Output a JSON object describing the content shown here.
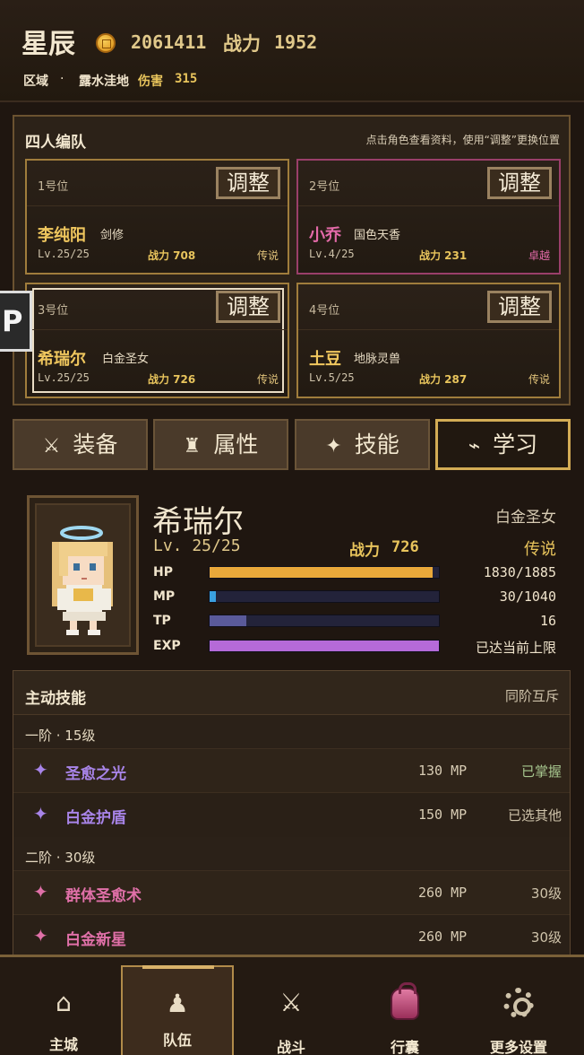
{
  "header": {
    "player_name": "星辰",
    "gold": "2061411",
    "power_label": "战力",
    "power_value": "1952",
    "region_label": "区域",
    "region_separator": "·",
    "region_name": "露水洼地",
    "damage_label": "伤害",
    "damage_value": "315"
  },
  "team": {
    "title": "四人编队",
    "hint": "点击角色查看资料，使用“调整”更换位置",
    "adjust_label": "调整",
    "slots": [
      {
        "pos": "1号位",
        "name": "李纯阳",
        "title": "剑修",
        "lv": "Lv.25/25",
        "power": "战力 708",
        "rank": "传说"
      },
      {
        "pos": "2号位",
        "name": "小乔",
        "title": "国色天香",
        "lv": "Lv.4/25",
        "power": "战力 231",
        "rank": "卓越"
      },
      {
        "pos": "3号位",
        "name": "希瑞尔",
        "title": "白金圣女",
        "lv": "Lv.25/25",
        "power": "战力 726",
        "rank": "传说"
      },
      {
        "pos": "4号位",
        "name": "土豆",
        "title": "地脉灵兽",
        "lv": "Lv.5/25",
        "power": "战力 287",
        "rank": "传说"
      }
    ],
    "side_tab": "P"
  },
  "tabs": [
    {
      "icon": "⚔",
      "label": "装备"
    },
    {
      "icon": "♜",
      "label": "属性"
    },
    {
      "icon": "✦",
      "label": "技能"
    },
    {
      "icon": "⌁",
      "label": "学习"
    }
  ],
  "hero": {
    "name": "希瑞尔",
    "class": "白金圣女",
    "lv": "Lv. 25/25",
    "power_label": "战力",
    "power_value": "726",
    "rank": "传说",
    "stats": [
      {
        "label": "HP",
        "value": "1830/1885",
        "fraction": 0.971,
        "color": "#e9a83a"
      },
      {
        "label": "MP",
        "value": "30/1040",
        "fraction": 0.029,
        "color": "#3aa0e0"
      },
      {
        "label": "TP",
        "value": "16",
        "fraction": 0.16,
        "color": "#5a5a9a"
      },
      {
        "label": "EXP",
        "value": "已达当前上限",
        "fraction": 1.0,
        "color": "#b56ad8"
      }
    ]
  },
  "skills": {
    "title": "主动技能",
    "note": "同阶互斥",
    "tiers": [
      {
        "label": "一阶 · 15级",
        "items": [
          {
            "name": "圣愈之光",
            "cost": "130 MP",
            "status": "已掌握",
            "color": "#a884e8"
          },
          {
            "name": "白金护盾",
            "cost": "150 MP",
            "status": "已选其他",
            "color": "#a884e8"
          }
        ]
      },
      {
        "label": "二阶 · 30级",
        "items": [
          {
            "name": "群体圣愈术",
            "cost": "260 MP",
            "status": "30级",
            "color": "#e070a8"
          },
          {
            "name": "白金新星",
            "cost": "260 MP",
            "status": "30级",
            "color": "#e070a8"
          }
        ]
      }
    ]
  },
  "nav": [
    {
      "label": "主城",
      "icon": "⌂"
    },
    {
      "label": "队伍",
      "icon": "♟"
    },
    {
      "label": "战斗",
      "icon": "⚔"
    },
    {
      "label": "行囊",
      "icon": ""
    },
    {
      "label": "更多设置",
      "icon": ""
    }
  ]
}
